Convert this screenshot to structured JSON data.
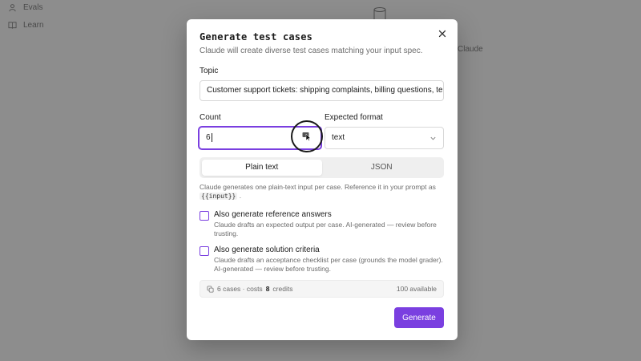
{
  "background": {
    "nav": [
      {
        "label": "Evals",
        "icon": "user-icon"
      },
      {
        "label": "Learn",
        "icon": "book-icon"
      }
    ],
    "side_text": "Claude"
  },
  "modal": {
    "title": "Generate test cases",
    "subtitle": "Claude will create diverse test cases matching your input spec.",
    "topic": {
      "label": "Topic",
      "value": "Customer support tickets: shipping complaints, billing questions, te"
    },
    "count": {
      "label": "Count",
      "value": "6"
    },
    "format": {
      "label": "Expected format",
      "selected": "text"
    },
    "segmented": {
      "options": [
        "Plain text",
        "JSON"
      ],
      "active": "Plain text"
    },
    "hint": {
      "text": "Claude generates one plain-text input per case. Reference it in your prompt as",
      "code": "{{input}}",
      "suffix": "."
    },
    "options": [
      {
        "title": "Also generate reference answers",
        "desc": "Claude drafts an expected output per case. AI-generated — review before trusting.",
        "checked": false
      },
      {
        "title": "Also generate solution criteria",
        "desc": "Claude drafts an acceptance checklist per case (grounds the model grader). AI-generated — review before trusting.",
        "checked": false
      }
    ],
    "credits": {
      "cases": "6 cases · costs",
      "cost": "8",
      "unit": "credits",
      "available": "100 available"
    },
    "generate_label": "Generate"
  },
  "colors": {
    "accent": "#7a3fe0",
    "overlay": "#8d8d8d"
  }
}
